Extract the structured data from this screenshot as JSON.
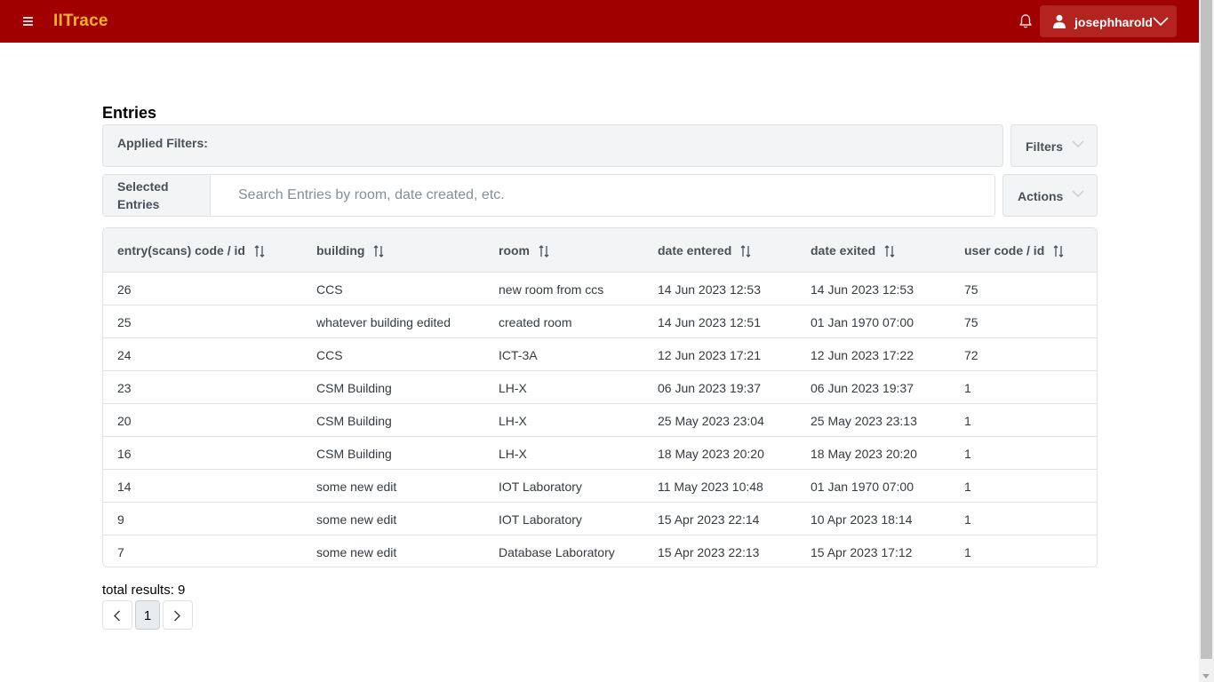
{
  "app": {
    "brand": "IITrace"
  },
  "navbar": {
    "username": "josephharold"
  },
  "page": {
    "title": "Entries"
  },
  "filters": {
    "applied_label": "Applied Filters:",
    "filters_button": "Filters"
  },
  "search": {
    "prefix_label": "Selected Entries",
    "placeholder": "Search Entries by room, date created, etc.",
    "value": "",
    "actions_button": "Actions"
  },
  "table": {
    "columns": [
      {
        "label": "entry(scans) code / id"
      },
      {
        "label": "building"
      },
      {
        "label": "room"
      },
      {
        "label": "date entered"
      },
      {
        "label": "date exited"
      },
      {
        "label": "user code / id"
      }
    ],
    "rows": [
      {
        "id": "26",
        "building": "CCS",
        "room": "new room from ccs",
        "entered": "14 Jun 2023 12:53",
        "exited": "14 Jun 2023 12:53",
        "user": "75"
      },
      {
        "id": "25",
        "building": "whatever building edited",
        "room": "created room",
        "entered": "14 Jun 2023 12:51",
        "exited": "01 Jan 1970 07:00",
        "user": "75"
      },
      {
        "id": "24",
        "building": "CCS",
        "room": "ICT-3A",
        "entered": "12 Jun 2023 17:21",
        "exited": "12 Jun 2023 17:22",
        "user": "72"
      },
      {
        "id": "23",
        "building": "CSM Building",
        "room": "LH-X",
        "entered": "06 Jun 2023 19:37",
        "exited": "06 Jun 2023 19:37",
        "user": "1"
      },
      {
        "id": "20",
        "building": "CSM Building",
        "room": "LH-X",
        "entered": "25 May 2023 23:04",
        "exited": "25 May 2023 23:13",
        "user": "1"
      },
      {
        "id": "16",
        "building": "CSM Building",
        "room": "LH-X",
        "entered": "18 May 2023 20:20",
        "exited": "18 May 2023 20:20",
        "user": "1"
      },
      {
        "id": "14",
        "building": "some new edit",
        "room": "IOT Laboratory",
        "entered": "11 May 2023 10:48",
        "exited": "01 Jan 1970 07:00",
        "user": "1"
      },
      {
        "id": "9",
        "building": "some new edit",
        "room": "IOT Laboratory",
        "entered": "15 Apr 2023 22:14",
        "exited": "10 Apr 2023 18:14",
        "user": "1"
      },
      {
        "id": "7",
        "building": "some new edit",
        "room": "Database Laboratory",
        "entered": "15 Apr 2023 22:13",
        "exited": "15 Apr 2023 17:12",
        "user": "1"
      }
    ]
  },
  "pagination": {
    "total_text": "total results: 9",
    "current_page": "1"
  },
  "colors": {
    "navbar": "#a10000",
    "brand": "#f7b31b",
    "user_button": "#b3231f",
    "panel_bg": "#f3f4f6",
    "border": "#dee2e6"
  },
  "icons": [
    "menu-icon",
    "bell-icon",
    "user-icon",
    "chevron-down-icon",
    "sort-icon",
    "chevron-left-icon",
    "chevron-right-icon"
  ]
}
